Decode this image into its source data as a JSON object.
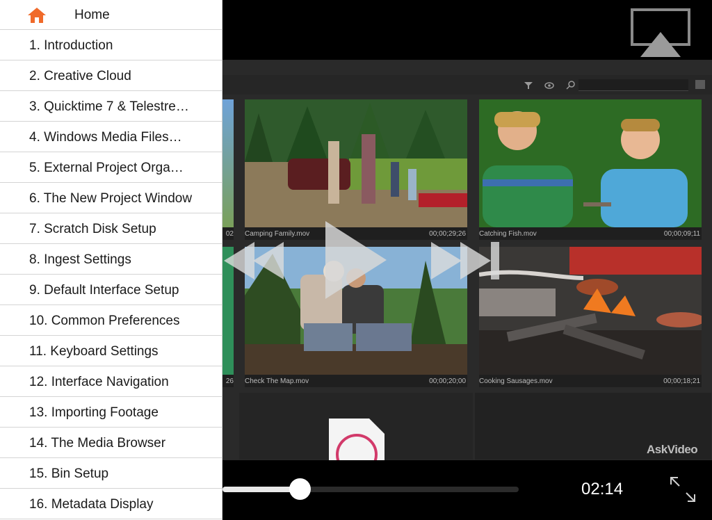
{
  "sidebar": {
    "home_label": "Home",
    "items": [
      {
        "label": "1. Introduction"
      },
      {
        "label": "2. Creative Cloud"
      },
      {
        "label": "3. Quicktime 7 & Telestre…"
      },
      {
        "label": "4. Windows Media Files…"
      },
      {
        "label": "5. External Project Orga…"
      },
      {
        "label": "6. The New Project Window"
      },
      {
        "label": "7. Scratch Disk Setup"
      },
      {
        "label": "8. Ingest Settings"
      },
      {
        "label": "9. Default Interface Setup"
      },
      {
        "label": "10. Common Preferences"
      },
      {
        "label": "11. Keyboard Settings"
      },
      {
        "label": "12. Interface Navigation"
      },
      {
        "label": "13. Importing Footage"
      },
      {
        "label": "14. The Media Browser"
      },
      {
        "label": "15. Bin Setup"
      },
      {
        "label": "16. Metadata Display"
      }
    ]
  },
  "media_bin": {
    "clips": [
      {
        "name": "Camping Family.mov",
        "duration": "00;00;29;26"
      },
      {
        "name": "Catching Fish.mov",
        "duration": "00;00;09;11"
      },
      {
        "name": "Check The Map.mov",
        "duration": "00;00;20;00"
      },
      {
        "name": "Cooking Sausages.mov",
        "duration": "00;00;18;21"
      }
    ],
    "partial_left_top": "02",
    "partial_left_bottom": "26"
  },
  "player": {
    "current_time": "02:14",
    "progress_fraction": 0.26,
    "watermark": "AskVideo"
  },
  "colors": {
    "home_icon": "#f06a2a",
    "sidebar_bg": "#ffffff",
    "panel_bg": "#2a2a2a"
  },
  "icons": {
    "home": "home-icon",
    "airplay": "airplay-icon",
    "filter": "filter-icon",
    "view": "eye-icon",
    "search": "search-icon",
    "rewind": "rewind-icon",
    "play": "play-icon",
    "forward": "fast-forward-icon",
    "fullscreen": "fullscreen-icon",
    "music": "music-file-icon"
  }
}
